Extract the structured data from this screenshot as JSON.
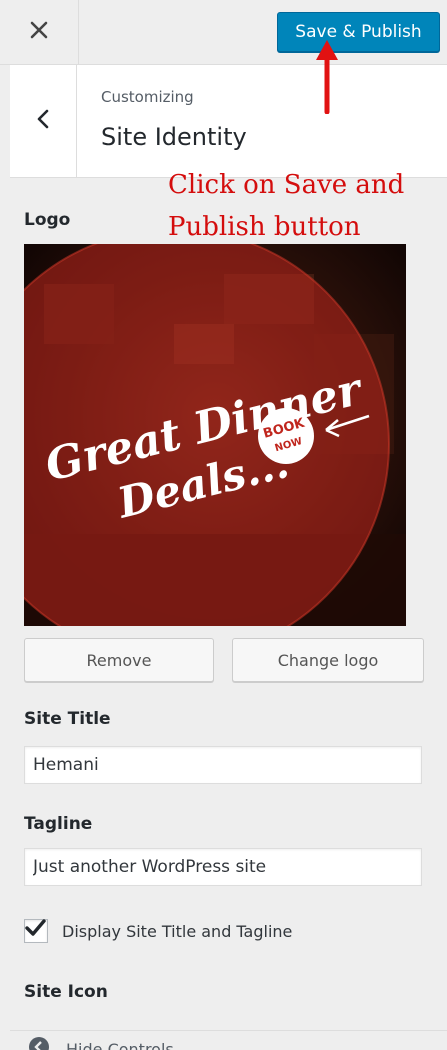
{
  "topbar": {
    "close_icon": "close-icon",
    "save_publish_label": "Save & Publish"
  },
  "section": {
    "back_icon": "chevron-left-icon",
    "breadcrumb": "Customizing",
    "title": "Site Identity"
  },
  "annotation": {
    "line1": "Click on Save and",
    "line2": "Publish button",
    "color": "#d40d0d"
  },
  "logo": {
    "label": "Logo",
    "image_text": [
      "Great Dinner",
      "Deals...",
      "BOOK",
      "NOW"
    ],
    "remove_label": "Remove",
    "change_label": "Change logo"
  },
  "site_title": {
    "label": "Site Title",
    "value": "Hemani"
  },
  "tagline": {
    "label": "Tagline",
    "value": "Just another WordPress site"
  },
  "display_title": {
    "label": "Display Site Title and Tagline",
    "checked": true
  },
  "site_icon": {
    "label": "Site Icon"
  },
  "footer": {
    "hide_controls_label": "Hide Controls",
    "icon": "collapse-icon"
  },
  "colors": {
    "primary_button": "#0085ba",
    "annotation_red": "#d40d0d",
    "panel_bg": "#eeeeee"
  }
}
